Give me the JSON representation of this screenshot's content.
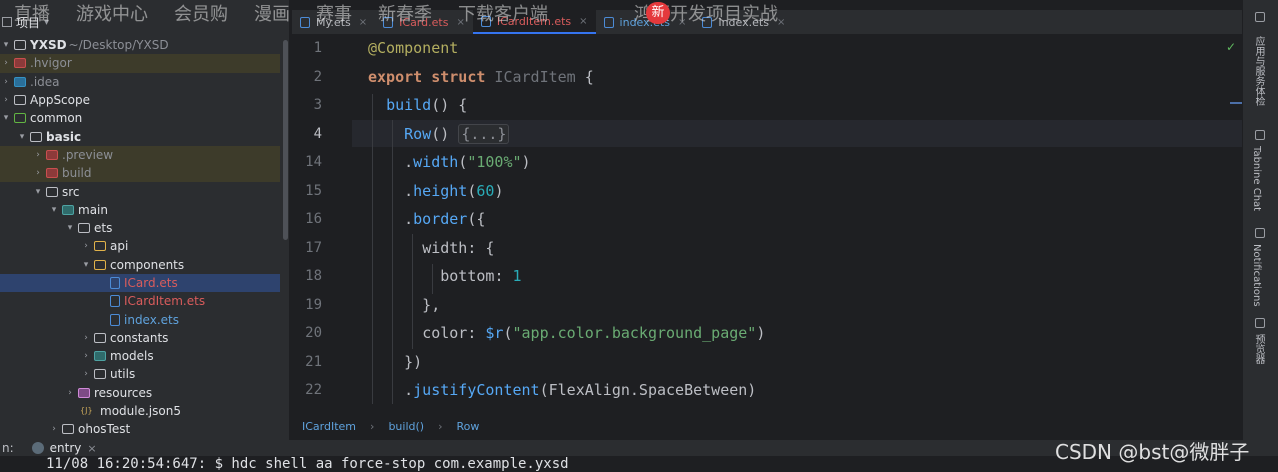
{
  "overlay_nav": {
    "items": [
      "直播",
      "游戏中心",
      "会员购",
      "漫画",
      "赛事",
      "新春季",
      "下载客户端",
      "鸿蒙开发项目实战"
    ],
    "badge": "新"
  },
  "project_panel": {
    "header": "项目",
    "tree": [
      {
        "label": "YXSD",
        "path": "~/Desktop/YXSD",
        "bold": true
      },
      {
        "label": ".hvigor"
      },
      {
        "label": ".idea"
      },
      {
        "label": "AppScope"
      },
      {
        "label": "common"
      },
      {
        "label": "basic"
      },
      {
        "label": ".preview"
      },
      {
        "label": "build"
      },
      {
        "label": "src"
      },
      {
        "label": "main"
      },
      {
        "label": "ets"
      },
      {
        "label": "api"
      },
      {
        "label": "components"
      },
      {
        "label": "ICard.ets"
      },
      {
        "label": "ICardItem.ets"
      },
      {
        "label": "index.ets"
      },
      {
        "label": "constants"
      },
      {
        "label": "models"
      },
      {
        "label": "utils"
      },
      {
        "label": "resources"
      },
      {
        "label": "module.json5"
      },
      {
        "label": "ohosTest"
      }
    ]
  },
  "tabs": [
    {
      "label": "My.ets"
    },
    {
      "label": "ICard.ets"
    },
    {
      "label": "ICardItem.ets"
    },
    {
      "label": "index.ets"
    },
    {
      "label": "Index.ets"
    }
  ],
  "editor": {
    "line_numbers": [
      "1",
      "2",
      "3",
      "4",
      "14",
      "15",
      "16",
      "17",
      "18",
      "19",
      "20",
      "21",
      "22"
    ],
    "lines": [
      [
        {
          "t": "@Component",
          "c": "ann"
        }
      ],
      [
        {
          "t": "export",
          "c": "kw"
        },
        {
          "t": " ",
          "c": "plain"
        },
        {
          "t": "struct",
          "c": "kw"
        },
        {
          "t": " ICardItem ",
          "c": "type"
        },
        {
          "t": "{",
          "c": "plain"
        }
      ],
      [
        {
          "t": "  ",
          "c": "plain"
        },
        {
          "t": "build",
          "c": "fn"
        },
        {
          "t": "() {",
          "c": "plain"
        }
      ],
      [
        {
          "t": "    ",
          "c": "plain"
        },
        {
          "t": "Row",
          "c": "fn"
        },
        {
          "t": "() ",
          "c": "plain"
        },
        {
          "t": "{...}",
          "c": "folded"
        }
      ],
      [
        {
          "t": "    .",
          "c": "plain"
        },
        {
          "t": "width",
          "c": "fn"
        },
        {
          "t": "(",
          "c": "plain"
        },
        {
          "t": "\"100%\"",
          "c": "str"
        },
        {
          "t": ")",
          "c": "plain"
        }
      ],
      [
        {
          "t": "    .",
          "c": "plain"
        },
        {
          "t": "height",
          "c": "fn"
        },
        {
          "t": "(",
          "c": "plain"
        },
        {
          "t": "60",
          "c": "num"
        },
        {
          "t": ")",
          "c": "plain"
        }
      ],
      [
        {
          "t": "    .",
          "c": "plain"
        },
        {
          "t": "border",
          "c": "fn"
        },
        {
          "t": "({",
          "c": "plain"
        }
      ],
      [
        {
          "t": "      ",
          "c": "plain"
        },
        {
          "t": "width",
          "c": "plain"
        },
        {
          "t": ": {",
          "c": "plain"
        }
      ],
      [
        {
          "t": "        ",
          "c": "plain"
        },
        {
          "t": "bottom",
          "c": "plain"
        },
        {
          "t": ": ",
          "c": "plain"
        },
        {
          "t": "1",
          "c": "num"
        }
      ],
      [
        {
          "t": "      },",
          "c": "plain"
        }
      ],
      [
        {
          "t": "      ",
          "c": "plain"
        },
        {
          "t": "color",
          "c": "plain"
        },
        {
          "t": ": ",
          "c": "plain"
        },
        {
          "t": "$r",
          "c": "fn"
        },
        {
          "t": "(",
          "c": "plain"
        },
        {
          "t": "\"app.color.background_page\"",
          "c": "str"
        },
        {
          "t": ")",
          "c": "plain"
        }
      ],
      [
        {
          "t": "    })",
          "c": "plain"
        }
      ],
      [
        {
          "t": "    .",
          "c": "plain"
        },
        {
          "t": "justifyContent",
          "c": "fn"
        },
        {
          "t": "(FlexAlign.SpaceBetween)",
          "c": "plain"
        }
      ]
    ]
  },
  "breadcrumb": [
    "ICardItem",
    "build()",
    "Row"
  ],
  "right_tools": [
    "应用与服务体检",
    "Tabnine Chat",
    "Notifications",
    "预览器"
  ],
  "run_bar": {
    "prefix": "n:",
    "label": "entry"
  },
  "console": {
    "line": "11/08 16:20:54:647: $ hdc shell aa force-stop com.example.yxsd"
  },
  "watermark": "CSDN @bst@微胖子",
  "colors": {
    "accent": "#3574f0",
    "background": "#1e1f22",
    "panel": "#2b2d30"
  }
}
